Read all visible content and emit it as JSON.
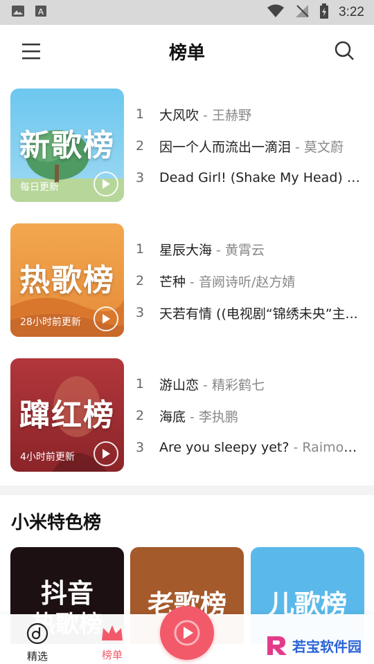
{
  "status_bar": {
    "time": "3:22"
  },
  "app_bar": {
    "title": "榜单"
  },
  "charts": [
    {
      "cover_title": "新歌榜",
      "update_text": "每日更新",
      "colors": {
        "top": "#6cc7ef",
        "bottom": "#9fd9f2"
      },
      "songs": [
        {
          "rank": "1",
          "name": "大风吹",
          "artist": " - 王赫野"
        },
        {
          "rank": "2",
          "name": "因一个人而流出一滴泪",
          "artist": " - 莫文蔚"
        },
        {
          "rank": "3",
          "name": "Dead Girl! (Shake My Head)",
          "artist": " - A..."
        }
      ]
    },
    {
      "cover_title": "热歌榜",
      "update_text": "28小时前更新",
      "colors": {
        "top": "#f3a74e",
        "bottom": "#e58a39"
      },
      "songs": [
        {
          "rank": "1",
          "name": "星辰大海",
          "artist": " - 黄霄云"
        },
        {
          "rank": "2",
          "name": "芒种",
          "artist": " - 音阙诗听/赵方婧"
        },
        {
          "rank": "3",
          "name": "天若有情 ((电视剧“锦绣未央”主...",
          "artist": ""
        }
      ]
    },
    {
      "cover_title": "蹿红榜",
      "update_text": "4小时前更新",
      "colors": {
        "top": "#b1373c",
        "bottom": "#8b2428"
      },
      "songs": [
        {
          "rank": "1",
          "name": "游山恋",
          "artist": " - 精彩鹤七"
        },
        {
          "rank": "2",
          "name": "海底",
          "artist": " - 李执鹏"
        },
        {
          "rank": "3",
          "name": "Are you sleepy yet?",
          "artist": " - Raimond..."
        }
      ]
    }
  ],
  "featured_section": {
    "title": "小米特色榜",
    "cards": [
      {
        "title": "抖音",
        "title2": "热歌榜",
        "color": "#1c1012"
      },
      {
        "title": "老歌榜",
        "title2": "",
        "color": "#a55a2c"
      },
      {
        "title": "儿歌榜",
        "title2": "",
        "color": "#5ab9ea"
      }
    ]
  },
  "bottom_nav": {
    "items": [
      {
        "label": "精选",
        "active": false
      },
      {
        "label": "榜单",
        "active": true
      }
    ],
    "accent": "#f25a6a"
  },
  "watermark": {
    "text": "若宝软件园"
  }
}
